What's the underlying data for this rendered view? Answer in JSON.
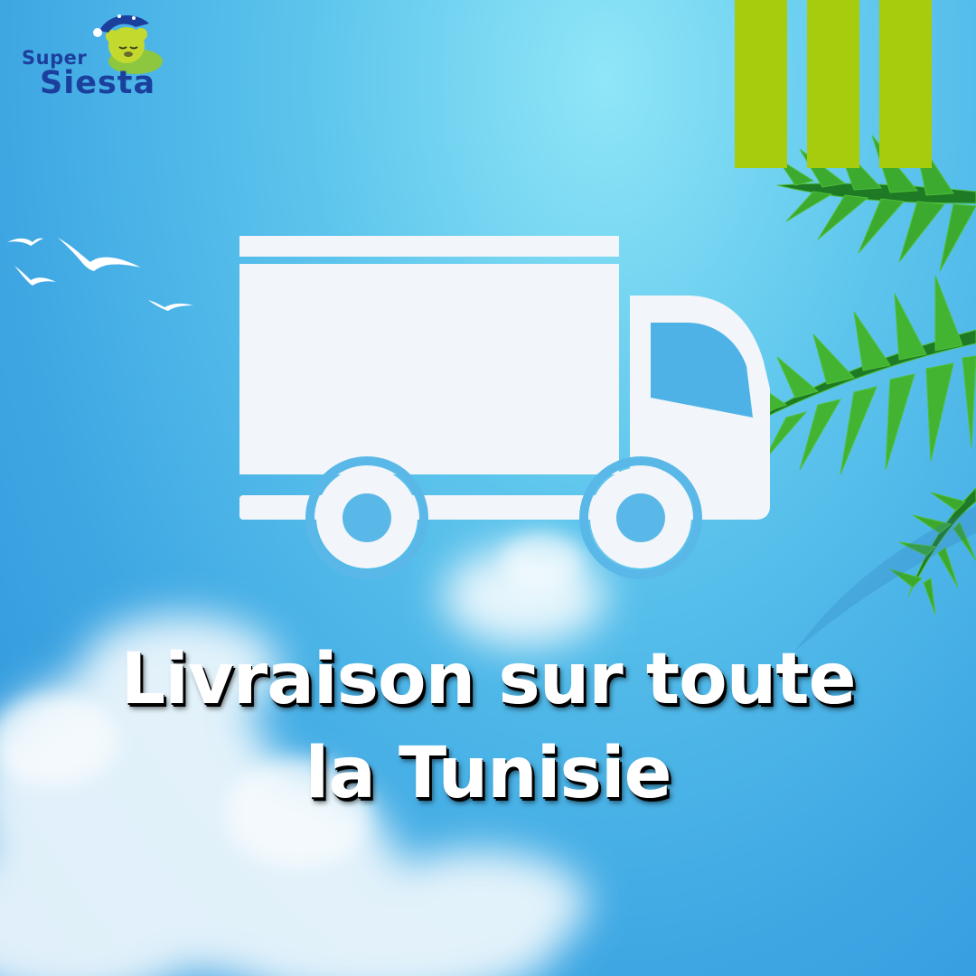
{
  "brand": {
    "logo_line1": "Super",
    "logo_line2": "Siesta"
  },
  "headline": {
    "line1": "Livraison sur toute",
    "line2": "la Tunisie"
  },
  "colors": {
    "sky_light": "#8fe6f7",
    "sky_dark": "#2f95da",
    "accent_green": "#a7cb0d",
    "logo_blue": "#1b3f9c",
    "truck_white": "#f2f5f9"
  },
  "icons": [
    "truck-icon",
    "bird-icon",
    "palm-leaf-icon",
    "teddy-bear-logo-icon"
  ]
}
